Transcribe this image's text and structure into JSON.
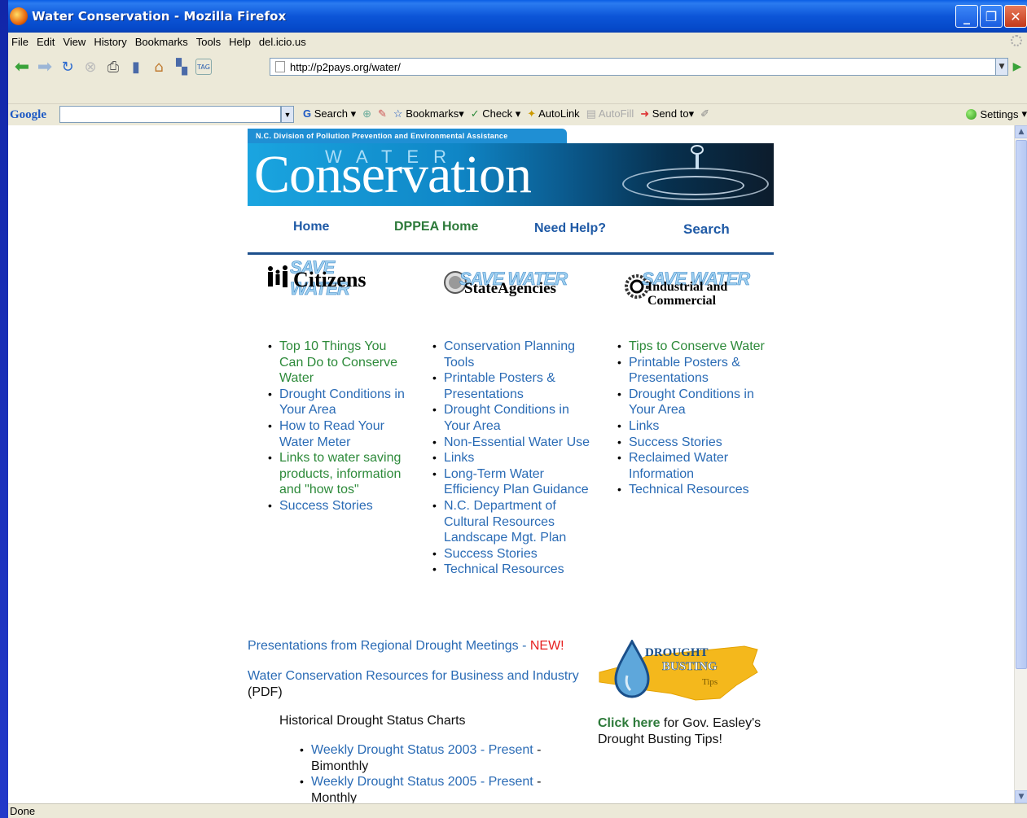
{
  "window": {
    "title": "Water Conservation - Mozilla Firefox",
    "minimize_glyph": "_",
    "maximize_glyph": "❐",
    "close_glyph": "✕"
  },
  "menu": [
    "File",
    "Edit",
    "View",
    "History",
    "Bookmarks",
    "Tools",
    "Help",
    "del.icio.us"
  ],
  "nav": {
    "url": "http://p2pays.org/water/",
    "tag_label": "TAG"
  },
  "google_toolbar": {
    "logo": "Google",
    "search_label": "Search",
    "bookmarks_label": "Bookmarks",
    "check_label": "Check",
    "autolink_label": "AutoLink",
    "autofill_label": "AutoFill",
    "sendto_label": "Send to",
    "settings_label": "Settings"
  },
  "status": "Done",
  "page": {
    "org_banner": "N.C. Division of Pollution Prevention and Environmental Assistance",
    "banner_water": "WATER",
    "banner_conservation": "Conservation",
    "topnav": [
      "Home",
      "DPPEA Home",
      "Need Help?",
      "Search"
    ],
    "columns": [
      {
        "save": "SAVE WATER",
        "title": "Citizens",
        "links": [
          "Top 10 Things You Can Do to Conserve Water",
          "Drought Conditions in Your Area",
          "How to Read Your Water Meter",
          "Links to water saving products, information and \"how tos\"",
          "Success Stories"
        ]
      },
      {
        "save": "SAVE WATER",
        "title": "StateAgencies",
        "links": [
          "Conservation Planning Tools",
          "Printable Posters & Presentations",
          "Drought Conditions in Your Area",
          "Non-Essential Water Use",
          "Links",
          "Long-Term Water Efficiency Plan Guidance",
          "N.C. Department of Cultural Resources Landscape Mgt. Plan",
          "Success Stories",
          "Technical Resources"
        ]
      },
      {
        "save": "SAVE WATER",
        "title_line1": "Industrial and",
        "title_line2": "Commercial",
        "links": [
          "Tips to Conserve Water",
          "Printable Posters & Presentations",
          "Drought Conditions in Your Area",
          "Links",
          "Success Stories",
          "Reclaimed Water Information",
          "Technical Resources"
        ]
      }
    ],
    "presentations_link": "Presentations from Regional Drought Meetings",
    "presentations_sep": " - ",
    "new_label": "NEW!",
    "business_link": "Water Conservation Resources for Business and Industry",
    "pdf_label": "(PDF)",
    "historical_heading": "Historical Drought Status Charts",
    "weekly": [
      {
        "link": "Weekly Drought Status 2003 - Present",
        "sep": " -",
        "freq": "Bimonthly"
      },
      {
        "link": "Weekly Drought Status 2005 - Present",
        "sep": " -",
        "freq": "Monthly"
      }
    ],
    "drought_logo_line1": "DROUGHT",
    "drought_logo_line2": "BUSTING",
    "drought_logo_line3": "Tips",
    "click_here": "Click here",
    "click_rest": " for Gov. Easley's Drought Busting Tips!"
  }
}
